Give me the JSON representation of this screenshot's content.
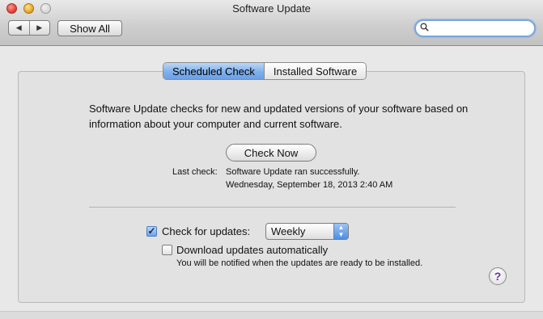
{
  "window": {
    "title": "Software Update"
  },
  "toolbar": {
    "back_icon": "back-arrow-icon",
    "forward_icon": "forward-arrow-icon",
    "show_all_label": "Show All",
    "search": {
      "value": "",
      "placeholder": ""
    }
  },
  "tabs": [
    {
      "label": "Scheduled Check",
      "active": true
    },
    {
      "label": "Installed Software",
      "active": false
    }
  ],
  "main": {
    "description": "Software Update checks for new and updated versions of your software based on information about your computer and current software.",
    "check_now_label": "Check Now",
    "last_check_label": "Last check:",
    "last_check_status": "Software Update ran successfully.",
    "last_check_time": "Wednesday, September 18, 2013 2:40 AM",
    "check_for_updates": {
      "checked": true,
      "label": "Check for updates:",
      "frequency": "Weekly"
    },
    "download_automatically": {
      "checked": false,
      "label": "Download updates automatically",
      "note": "You will be notified when the updates are ready to be installed."
    },
    "help_label": "?"
  },
  "colors": {
    "accent": "#6fa3e8",
    "help_glyph": "#6a2fa0"
  }
}
